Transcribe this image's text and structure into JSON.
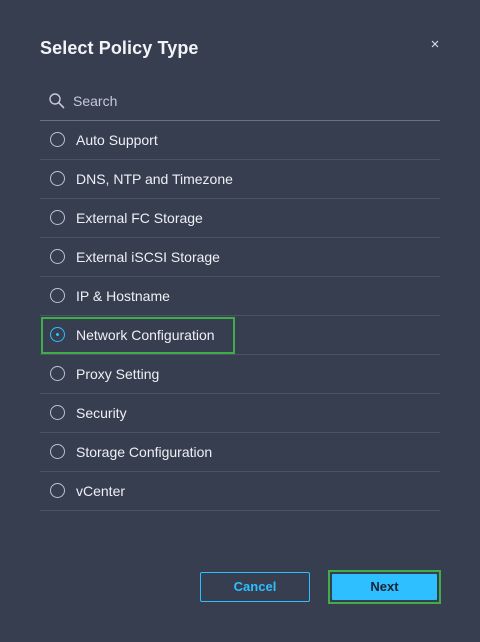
{
  "dialog": {
    "title": "Select Policy Type",
    "close_icon": "close-icon"
  },
  "search": {
    "placeholder": "Search",
    "value": "",
    "icon": "search-icon"
  },
  "options": [
    {
      "label": "Auto Support",
      "selected": false
    },
    {
      "label": "DNS, NTP and Timezone",
      "selected": false
    },
    {
      "label": "External FC Storage",
      "selected": false
    },
    {
      "label": "External iSCSI Storage",
      "selected": false
    },
    {
      "label": "IP & Hostname",
      "selected": false
    },
    {
      "label": "Network Configuration",
      "selected": true
    },
    {
      "label": "Proxy Setting",
      "selected": false
    },
    {
      "label": "Security",
      "selected": false
    },
    {
      "label": "Storage Configuration",
      "selected": false
    },
    {
      "label": "vCenter",
      "selected": false
    }
  ],
  "footer": {
    "cancel_label": "Cancel",
    "next_label": "Next"
  },
  "colors": {
    "background": "#373e50",
    "accent": "#2dbfff",
    "highlight": "#3fae4a"
  }
}
